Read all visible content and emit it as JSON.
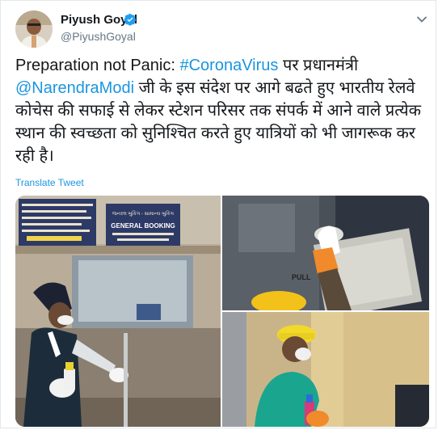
{
  "author": {
    "name": "Piyush Goyal",
    "handle": "@PiyushGoyal"
  },
  "icons": {
    "verified": "verified-badge-icon",
    "more": "chevron-down-icon",
    "avatar": "user-avatar"
  },
  "tweet": {
    "part1": "Preparation not Panic: ",
    "hashtag": "#CoronaVirus",
    "part2": " पर प्रधानमंत्री ",
    "mention": "@NarendraModi",
    "part3": " जी के इस संदेश पर आगे बढते हुए भारतीय रेलवे कोचेस की सफाई से लेकर स्टेशन परिसर तक संपर्क में आने वाले प्रत्येक स्थान की स्वच्छता को सुनिश्चित करते हुए यात्रियों को भी जागरूक कर रही है।"
  },
  "translate_label": "Translate Tweet",
  "media": {
    "photo1": {
      "sign_title": "જનરલ બુકિંગ - સામાન્ય બુકિંગ",
      "sign_subtitle": "GENERAL BOOKING"
    },
    "photo3": {
      "door_label": "PULL"
    }
  },
  "colors": {
    "link": "#1b95e0",
    "text": "#14171a",
    "muted": "#657786"
  }
}
